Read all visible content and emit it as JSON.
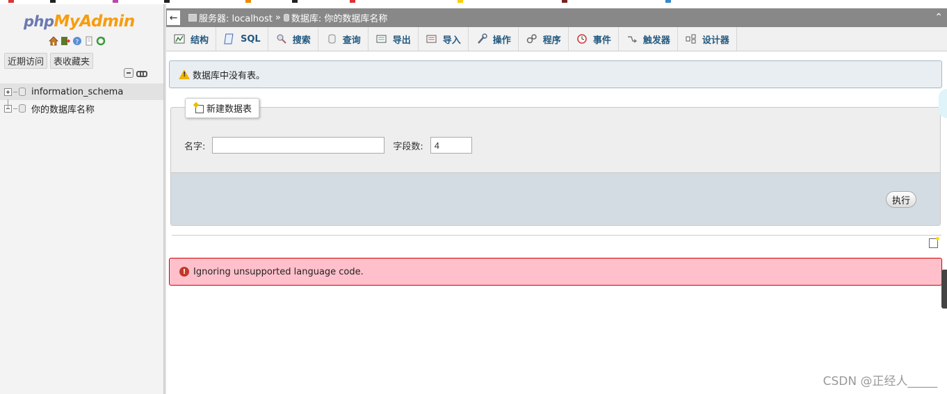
{
  "logo": {
    "php": "php",
    "my": "My",
    "admin": "Admin"
  },
  "nav": {
    "tabs": [
      "近期访问",
      "表收藏夹"
    ],
    "databases": [
      "information_schema",
      "你的数据库名称"
    ]
  },
  "breadcrumb": {
    "server": "服务器: localhost",
    "separator": "»",
    "database": "数据库: 你的数据库名称"
  },
  "tabs": [
    {
      "label": "结构",
      "icon": "structure-icon"
    },
    {
      "label": "SQL",
      "icon": "sql-icon"
    },
    {
      "label": "搜索",
      "icon": "search-icon"
    },
    {
      "label": "查询",
      "icon": "query-icon"
    },
    {
      "label": "导出",
      "icon": "export-icon"
    },
    {
      "label": "导入",
      "icon": "import-icon"
    },
    {
      "label": "操作",
      "icon": "wrench-icon"
    },
    {
      "label": "程序",
      "icon": "routines-icon"
    },
    {
      "label": "事件",
      "icon": "clock-icon"
    },
    {
      "label": "触发器",
      "icon": "triggers-icon"
    },
    {
      "label": "设计器",
      "icon": "designer-icon"
    }
  ],
  "notice": {
    "text": "数据库中没有表。"
  },
  "create_table": {
    "legend": "新建数据表",
    "name_label": "名字:",
    "name_value": "",
    "fields_label": "字段数:",
    "fields_value": "4",
    "go_label": "执行"
  },
  "error": {
    "text": "Ignoring unsupported language code."
  },
  "watermark": "CSDN @正经人_____",
  "colors": {
    "topbar": "#888888",
    "tab_text": "#235a81",
    "notice_bg": "#e9eef3",
    "error_bg": "#ffc0cb",
    "logo_php": "#6c78af",
    "logo_myadmin": "#f89c0e"
  }
}
